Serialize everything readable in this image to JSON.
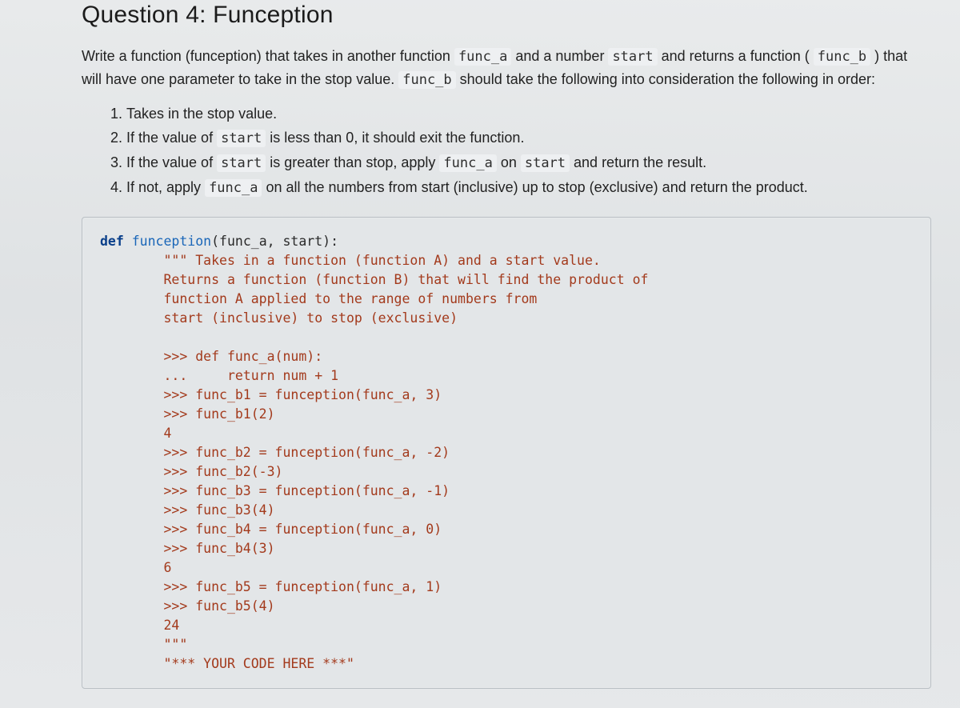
{
  "title": "Question 4: Funception",
  "intro": {
    "t1": "Write a function (funception) that takes in another function ",
    "c1": "func_a",
    "t2": " and a number ",
    "c2": "start",
    "t3": " and returns a function ( ",
    "c3": "func_b",
    "t4": " ) that will have one parameter to take in the stop value. ",
    "c4": "func_b",
    "t5": " should take the following into consideration the following in order:"
  },
  "list": {
    "i1": "Takes in the stop value.",
    "i2a": "If the value of ",
    "i2c": "start",
    "i2b": " is less than 0, it should exit the function.",
    "i3a": "If the value of ",
    "i3c1": "start",
    "i3b": " is greater than stop, apply ",
    "i3c2": "func_a",
    "i3c": " on ",
    "i3c3": "start",
    "i3d": " and return the result.",
    "i4a": "If not, apply ",
    "i4c": "func_a",
    "i4b": " on all the numbers from start (inclusive) up to stop (exclusive) and return the product."
  },
  "code": {
    "l1_def": "def ",
    "l1_fn": "funception",
    "l1_rest": "(func_a, start):",
    "l2": "        \"\"\" Takes in a function (function A) and a start value.",
    "l3": "        Returns a function (function B) that will find the product of",
    "l4": "        function A applied to the range of numbers from",
    "l5": "        start (inclusive) to stop (exclusive)",
    "l6": "",
    "l7": "        >>> def func_a(num):",
    "l8": "        ...     return num + 1",
    "l9": "        >>> func_b1 = funception(func_a, 3)",
    "l10": "        >>> func_b1(2)",
    "l11": "        4",
    "l12": "        >>> func_b2 = funception(func_a, -2)",
    "l13": "        >>> func_b2(-3)",
    "l14": "        >>> func_b3 = funception(func_a, -1)",
    "l15": "        >>> func_b3(4)",
    "l16": "        >>> func_b4 = funception(func_a, 0)",
    "l17": "        >>> func_b4(3)",
    "l18": "        6",
    "l19": "        >>> func_b5 = funception(func_a, 1)",
    "l20": "        >>> func_b5(4)",
    "l21": "        24",
    "l22": "        \"\"\"",
    "l23": "        \"*** YOUR CODE HERE ***\""
  }
}
